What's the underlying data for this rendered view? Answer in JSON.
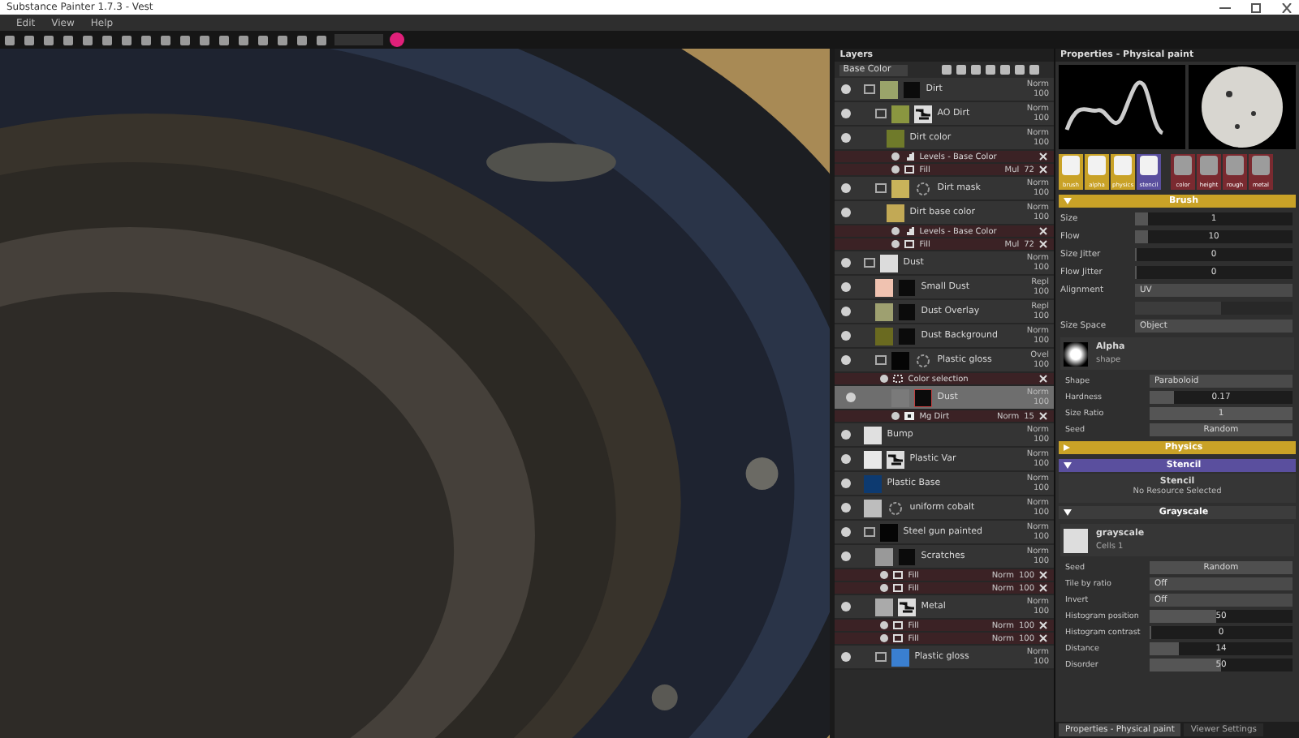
{
  "window": {
    "title": "Substance Painter 1.7.3 - Vest"
  },
  "menu": [
    "Edit",
    "View",
    "Help"
  ],
  "layers_panel": {
    "title": "Layers",
    "channel": "Base Color",
    "layers": [
      {
        "name": "Dirt",
        "folder": true,
        "color": "#9aa46a",
        "mask": {
          "kind": "dark"
        },
        "blend": "Norm",
        "opacity": "100",
        "selected": false,
        "children": [
          {
            "name": "AO Dirt",
            "folder": true,
            "color": "#8a9640",
            "mask": {
              "kind": "pattern"
            },
            "blend": "Norm",
            "opacity": "100",
            "selected": false,
            "children": [
              {
                "name": "Dirt color",
                "folder": false,
                "color": "#6f7a2a",
                "blend": "Norm",
                "opacity": "100",
                "selected": false,
                "effects": [
                  {
                    "name": "Levels - Base Color",
                    "kind": "levels"
                  },
                  {
                    "name": "Fill",
                    "kind": "fill",
                    "blend": "Mul",
                    "opacity": "72"
                  }
                ]
              }
            ]
          },
          {
            "name": "Dirt mask",
            "folder": true,
            "color": "#c9b35a",
            "mask": {
              "kind": "ring"
            },
            "blend": "Norm",
            "opacity": "100",
            "selected": false,
            "children": [
              {
                "name": "Dirt base color",
                "folder": false,
                "color": "#c2a955",
                "blend": "Norm",
                "opacity": "100",
                "selected": false,
                "effects": [
                  {
                    "name": "Levels - Base Color",
                    "kind": "levels"
                  },
                  {
                    "name": "Fill",
                    "kind": "fill",
                    "blend": "Mul",
                    "opacity": "72"
                  }
                ]
              }
            ]
          }
        ]
      },
      {
        "name": "Dust",
        "folder": true,
        "color": "#dcdcdc",
        "blend": "Norm",
        "opacity": "100",
        "selected": false,
        "children": [
          {
            "name": "Small Dust",
            "folder": false,
            "color": "#f0c2b0",
            "mask": {
              "kind": "dark"
            },
            "blend": "Repl",
            "opacity": "100",
            "selected": false
          },
          {
            "name": "Dust Overlay",
            "folder": false,
            "color": "#9ea070",
            "mask": {
              "kind": "dark"
            },
            "blend": "Repl",
            "opacity": "100",
            "selected": false
          },
          {
            "name": "Dust Background",
            "folder": false,
            "color": "#6a6a20",
            "mask": {
              "kind": "dark"
            },
            "blend": "Norm",
            "opacity": "100",
            "selected": false
          },
          {
            "name": "Plastic gloss",
            "folder": true,
            "color": "#050505",
            "mask": {
              "kind": "ring"
            },
            "blend": "Ovel",
            "opacity": "100",
            "selected": false,
            "effects": [
              {
                "name": "Color selection",
                "kind": "selection"
              }
            ],
            "children": [
              {
                "name": "Dust",
                "folder": false,
                "color": "#7a7a7a",
                "mask": {
                  "kind": "dark"
                },
                "blend": "Norm",
                "opacity": "100",
                "selected": true,
                "effects": [
                  {
                    "name": "Mg Dirt",
                    "kind": "filter",
                    "blend": "Norm",
                    "opacity": "15"
                  }
                ]
              }
            ]
          }
        ]
      },
      {
        "name": "Bump",
        "folder": false,
        "color": "#e0e0e0",
        "blend": "Norm",
        "opacity": "100",
        "selected": false
      },
      {
        "name": "Plastic Var",
        "folder": false,
        "color": "#e8e8e8",
        "mask": {
          "kind": "pattern"
        },
        "blend": "Norm",
        "opacity": "100",
        "selected": false
      },
      {
        "name": "Plastic Base",
        "folder": false,
        "color": "#0d3a70",
        "blend": "Norm",
        "opacity": "100",
        "selected": false
      },
      {
        "name": "uniform cobalt",
        "folder": false,
        "color": "#bdbdbd",
        "mask": {
          "kind": "ring"
        },
        "blend": "Norm",
        "opacity": "100",
        "selected": false
      },
      {
        "name": "Steel gun painted",
        "folder": true,
        "color": "#050505",
        "blend": "Norm",
        "opacity": "100",
        "selected": false,
        "children": [
          {
            "name": "Scratches",
            "folder": false,
            "color": "#999999",
            "mask": {
              "kind": "dark"
            },
            "blend": "Norm",
            "opacity": "100",
            "selected": false,
            "effects": [
              {
                "name": "Fill",
                "kind": "fill",
                "blend": "Norm",
                "opacity": "100"
              },
              {
                "name": "Fill",
                "kind": "fill",
                "blend": "Norm",
                "opacity": "100"
              }
            ]
          },
          {
            "name": "Metal",
            "folder": false,
            "color": "#aaaaaa",
            "mask": {
              "kind": "pattern"
            },
            "blend": "Norm",
            "opacity": "100",
            "selected": false,
            "effects": [
              {
                "name": "Fill",
                "kind": "fill",
                "blend": "Norm",
                "opacity": "100"
              },
              {
                "name": "Fill",
                "kind": "fill",
                "blend": "Norm",
                "opacity": "100"
              }
            ]
          },
          {
            "name": "Plastic gloss",
            "folder": true,
            "color": "#3a7fd0",
            "blend": "Norm",
            "opacity": "100",
            "selected": false
          }
        ]
      }
    ]
  },
  "properties": {
    "title": "Properties - Physical paint",
    "tool_slots": [
      {
        "label": "brush",
        "color": "#c9a227"
      },
      {
        "label": "alpha",
        "color": "#c9a227"
      },
      {
        "label": "physics",
        "color": "#c9a227"
      },
      {
        "label": "stencil",
        "color": "#5a4f9e"
      }
    ],
    "material_slots": [
      {
        "label": "color"
      },
      {
        "label": "height"
      },
      {
        "label": "rough"
      },
      {
        "label": "metal"
      }
    ],
    "brush": {
      "title": "Brush",
      "expanded": true,
      "rows": [
        {
          "label": "Size",
          "kind": "slider",
          "value": "1",
          "level": 0.08
        },
        {
          "label": "Flow",
          "kind": "slider",
          "value": "10",
          "level": 0.08
        },
        {
          "label": "Size Jitter",
          "kind": "slider",
          "value": "0",
          "level": 0
        },
        {
          "label": "Flow Jitter",
          "kind": "slider",
          "value": "0",
          "level": 0
        },
        {
          "label": "Alignment",
          "kind": "select",
          "value": "UV"
        },
        {
          "kind": "slider",
          "disabled": true,
          "level": 0.55
        },
        {
          "label": "Size Space",
          "kind": "select",
          "value": "Object"
        }
      ],
      "alpha": {
        "title": "Alpha",
        "subtitle": "shape",
        "rows": [
          {
            "label": "Shape",
            "kind": "select",
            "value": "Paraboloid"
          },
          {
            "label": "Hardness",
            "kind": "slider",
            "value": "0.17",
            "level": 0.17
          },
          {
            "label": "Size Ratio",
            "kind": "slider",
            "value": "1",
            "level": 1
          },
          {
            "label": "Seed",
            "kind": "button",
            "value": "Random"
          }
        ]
      }
    },
    "physics": {
      "title": "Physics",
      "expanded": false
    },
    "stencil": {
      "title": "Stencil",
      "expanded": true,
      "heading": "Stencil",
      "message": "No Resource Selected"
    },
    "grayscale": {
      "title": "Grayscale",
      "expanded": true,
      "name": "grayscale",
      "subtitle": "Cells 1",
      "rows": [
        {
          "label": "Seed",
          "kind": "button",
          "value": "Random"
        },
        {
          "label": "Tile by ratio",
          "kind": "select",
          "value": "Off"
        },
        {
          "label": "Invert",
          "kind": "select",
          "value": "Off"
        },
        {
          "label": "Histogram position",
          "kind": "slider",
          "value": "50",
          "level": 0.47
        },
        {
          "label": "Histogram contrast",
          "kind": "slider",
          "value": "0",
          "level": 0
        },
        {
          "label": "Distance",
          "kind": "slider",
          "value": "14",
          "level": 0.2
        },
        {
          "label": "Disorder",
          "kind": "slider",
          "value": "50",
          "level": 0.5
        }
      ]
    },
    "tabs": [
      {
        "label": "Properties - Physical paint",
        "selected": true
      },
      {
        "label": "Viewer Settings",
        "selected": false
      }
    ]
  }
}
